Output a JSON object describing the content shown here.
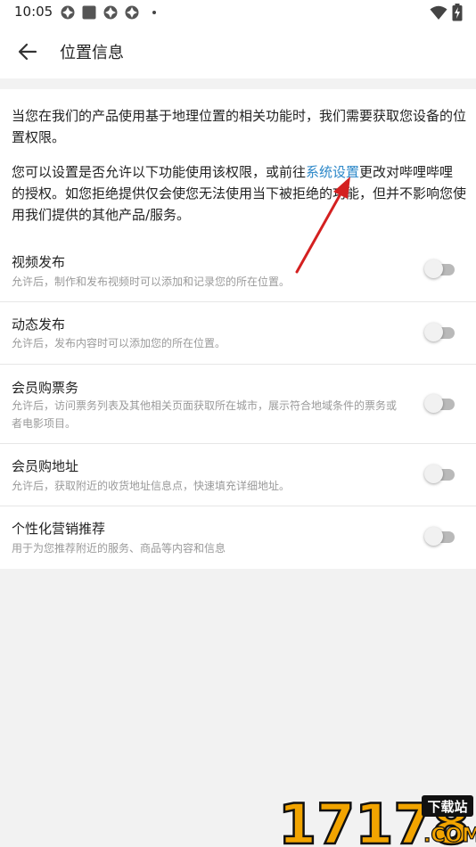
{
  "status_bar": {
    "time": "10:05",
    "icons": [
      "app-notification-icon",
      "square-notification-icon",
      "app-notification-icon",
      "app-notification-icon",
      "more-dot-icon",
      "wifi-icon",
      "battery-charging-icon"
    ]
  },
  "header": {
    "title": "位置信息",
    "back_icon": "arrow-left-icon"
  },
  "intro": {
    "paragraph1": "当您在我们的产品使用基于地理位置的相关功能时，我们需要获取您设备的位置权限。",
    "paragraph2_before": "您可以设置是否允许以下功能使用该权限，或前往",
    "paragraph2_link": "系统设置",
    "paragraph2_after": "更改对哔哩哔哩的授权。如您拒绝提供仅会使您无法使用当下被拒绝的功能，但并不影响您使用我们提供的其他产品/服务。"
  },
  "settings": [
    {
      "title": "视频发布",
      "desc": "允许后，制作和发布视频时可以添加和记录您的所在位置。",
      "enabled": false
    },
    {
      "title": "动态发布",
      "desc": "允许后，发布内容时可以添加您的所在位置。",
      "enabled": false
    },
    {
      "title": "会员购票务",
      "desc": "允许后，访问票务列表及其他相关页面获取所在城市，展示符合地域条件的票务或者电影项目。",
      "enabled": false
    },
    {
      "title": "会员购地址",
      "desc": "允许后，获取附近的收货地址信息点，快速填充详细地址。",
      "enabled": false
    },
    {
      "title": "个性化营销推荐",
      "desc": "用于为您推荐附近的服务、商品等内容和信息",
      "enabled": false
    }
  ],
  "watermark": {
    "text": "17178",
    "badge": "下载站",
    "suffix": ".COM"
  },
  "colors": {
    "link": "#2b87c8",
    "annotation_arrow": "#d42020",
    "toggle_off_track": "#b9b9b9"
  }
}
